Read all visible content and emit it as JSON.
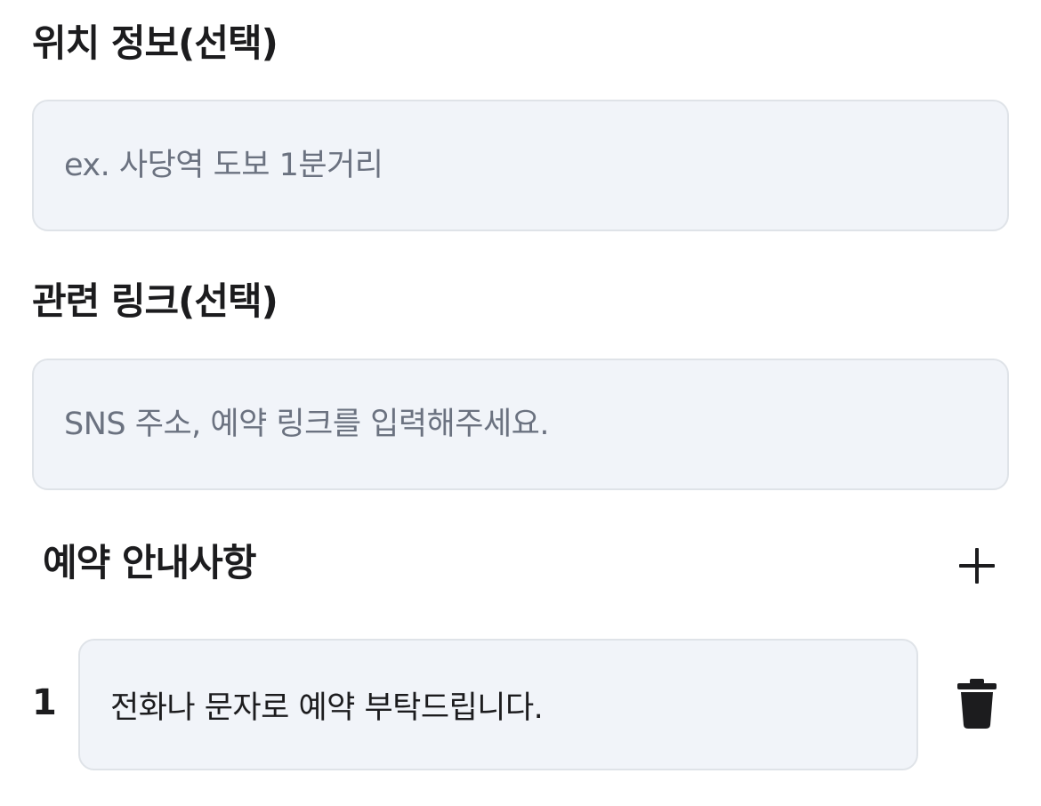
{
  "location": {
    "title": "위치 정보(선택)",
    "placeholder": "ex. 사당역 도보 1분거리"
  },
  "link": {
    "title": "관련 링크(선택)",
    "placeholder": "SNS 주소, 예약 링크를 입력해주세요."
  },
  "reservation_notes": {
    "title": "예약 안내사항",
    "add_icon": "plus-icon",
    "items": [
      {
        "index": "1",
        "text": "전화나 문자로 예약 부탁드립니다.",
        "delete_icon": "trash-icon"
      }
    ]
  },
  "colors": {
    "field_bg": "#f1f4f9",
    "field_border": "#dfe3e8",
    "text": "#1c1c1e",
    "placeholder": "#6b7280"
  }
}
